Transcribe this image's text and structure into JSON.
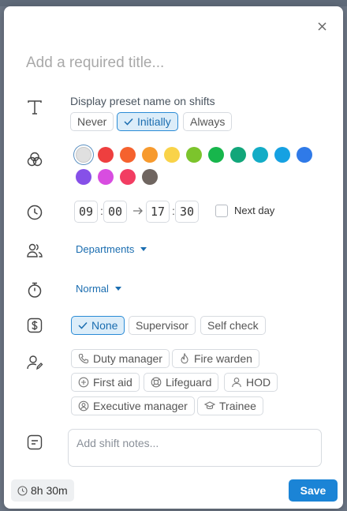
{
  "title": {
    "placeholder": "Add a required title..."
  },
  "display": {
    "label": "Display preset name on shifts",
    "options": [
      "Never",
      "Initially",
      "Always"
    ],
    "selected": "Initially"
  },
  "colors": {
    "selected": "#e0e0e0",
    "swatches": [
      "#e0e0e0",
      "#ee3f3f",
      "#f5622e",
      "#f79a2e",
      "#f9d349",
      "#7cc42c",
      "#17b64c",
      "#12a67a",
      "#13acc6",
      "#16a1e2",
      "#2f7ae8",
      "#8650e8",
      "#d84de0",
      "#f23d62",
      "#6f6560"
    ]
  },
  "time": {
    "start_hour": "09",
    "start_min": "00",
    "end_hour": "17",
    "end_min": "30",
    "colon": ":",
    "next_day_label": "Next day"
  },
  "departments": {
    "label": "Departments"
  },
  "priority": {
    "label": "Normal"
  },
  "pay": {
    "options": [
      "None",
      "Supervisor",
      "Self check"
    ],
    "selected": "None"
  },
  "roles": {
    "items": [
      {
        "label": "Duty manager",
        "icon": "phone-icon"
      },
      {
        "label": "Fire warden",
        "icon": "flame-icon"
      },
      {
        "label": "First aid",
        "icon": "plus-square-icon"
      },
      {
        "label": "Lifeguard",
        "icon": "lifebuoy-icon"
      },
      {
        "label": "HOD",
        "icon": "person-icon"
      },
      {
        "label": "Executive manager",
        "icon": "person-badge-icon"
      },
      {
        "label": "Trainee",
        "icon": "graduation-cap-icon"
      }
    ]
  },
  "notes": {
    "placeholder": "Add shift notes..."
  },
  "footer": {
    "duration": "8h 30m",
    "save_label": "Save"
  },
  "accent": "#1b84d6"
}
